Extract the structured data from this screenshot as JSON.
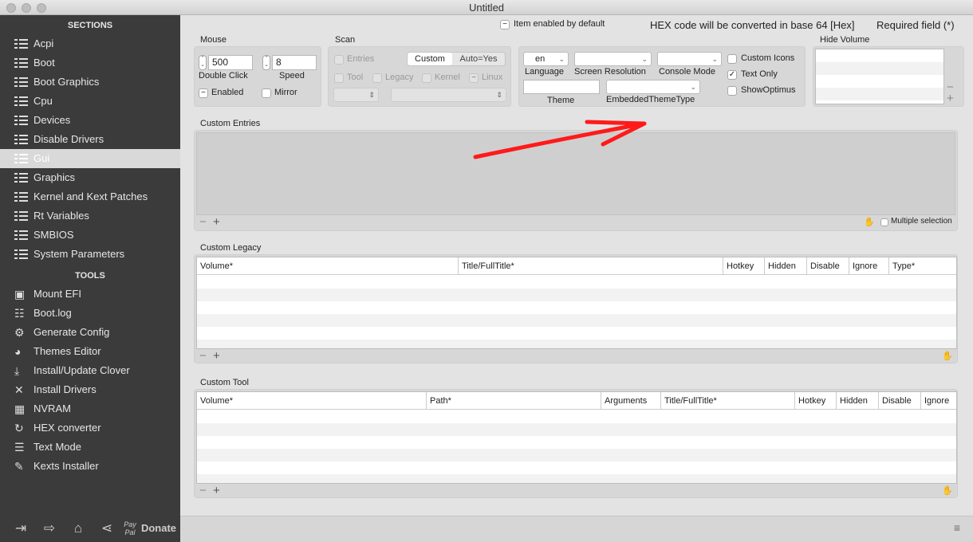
{
  "window": {
    "title": "Untitled"
  },
  "sidebar": {
    "sections_title": "SECTIONS",
    "sections": [
      {
        "label": "Acpi"
      },
      {
        "label": "Boot"
      },
      {
        "label": "Boot Graphics"
      },
      {
        "label": "Cpu"
      },
      {
        "label": "Devices"
      },
      {
        "label": "Disable Drivers"
      },
      {
        "label": "Gui",
        "selected": true
      },
      {
        "label": "Graphics"
      },
      {
        "label": "Kernel and Kext Patches"
      },
      {
        "label": "Rt Variables"
      },
      {
        "label": "SMBIOS"
      },
      {
        "label": "System Parameters"
      }
    ],
    "tools_title": "TOOLS",
    "tools": [
      {
        "label": "Mount EFI",
        "icon": "disk-icon"
      },
      {
        "label": "Boot.log",
        "icon": "log-search-icon"
      },
      {
        "label": "Generate Config",
        "icon": "gears-icon"
      },
      {
        "label": "Themes Editor",
        "icon": "palette-icon"
      },
      {
        "label": "Install/Update Clover",
        "icon": "download-icon"
      },
      {
        "label": "Install Drivers",
        "icon": "wrench-icon"
      },
      {
        "label": "NVRAM",
        "icon": "chip-icon"
      },
      {
        "label": "HEX converter",
        "icon": "refresh-icon"
      },
      {
        "label": "Text Mode",
        "icon": "text-lines-icon"
      },
      {
        "label": "Kexts Installer",
        "icon": "plug-icon"
      }
    ],
    "bottom": {
      "paypal": "Pay Pal",
      "donate": "Donate"
    }
  },
  "header": {
    "item_enabled": "Item enabled by default",
    "hex_note": "HEX code will be converted in base 64 [Hex]",
    "required": "Required field (*)"
  },
  "mouse": {
    "title": "Mouse",
    "double_click_value": "500",
    "double_click_label": "Double Click",
    "speed_value": "8",
    "speed_label": "Speed",
    "enabled": "Enabled",
    "mirror": "Mirror"
  },
  "scan": {
    "title": "Scan",
    "entries": "Entries",
    "seg_custom": "Custom",
    "seg_auto": "Auto=Yes",
    "tool": "Tool",
    "legacy": "Legacy",
    "kernel": "Kernel",
    "linux": "Linux"
  },
  "gui": {
    "language_value": "en",
    "language": "Language",
    "screen_resolution": "Screen Resolution",
    "console_mode": "Console Mode",
    "theme": "Theme",
    "embedded_theme_type": "EmbeddedThemeType",
    "custom_icons": "Custom Icons",
    "text_only": "Text Only",
    "show_optimus": "ShowOptimus"
  },
  "hide_volume": {
    "title": "Hide Volume"
  },
  "custom_entries": {
    "title": "Custom Entries",
    "multiple_selection": "Multiple selection"
  },
  "custom_legacy": {
    "title": "Custom Legacy",
    "columns": [
      "Volume*",
      "Title/FullTitle*",
      "Hotkey",
      "Hidden",
      "Disable",
      "Ignore",
      "Type*"
    ]
  },
  "custom_tool": {
    "title": "Custom Tool",
    "columns": [
      "Volume*",
      "Path*",
      "Arguments",
      "Title/FullTitle*",
      "Hotkey",
      "Hidden",
      "Disable",
      "Ignore"
    ]
  },
  "annotation": {
    "arrow_color": "#ff1a1a"
  }
}
